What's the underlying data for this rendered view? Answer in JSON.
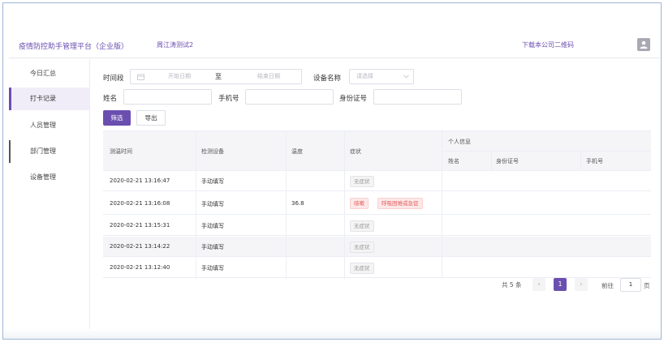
{
  "header": {
    "title": "疫情防控助手管理平台（企业版）",
    "tenant": "周江涛测试2",
    "qr_link": "下载本公司二维码"
  },
  "sidebar": {
    "items": [
      {
        "label": "今日汇总"
      },
      {
        "label": "打卡记录"
      },
      {
        "label": "人员管理"
      },
      {
        "label": "部门管理"
      },
      {
        "label": "设备管理"
      }
    ]
  },
  "filters": {
    "time_label": "时间段",
    "start_placeholder": "开始日期",
    "to_label": "至",
    "end_placeholder": "结束日期",
    "device_label": "设备名称",
    "device_placeholder": "请选择",
    "name_label": "姓名",
    "phone_label": "手机号",
    "id_label": "身份证号",
    "filter_button": "筛选",
    "export_button": "导出"
  },
  "table": {
    "columns": {
      "time": "测温时间",
      "device": "检测设备",
      "temp": "温度",
      "symptom": "症状",
      "personal": "个人信息",
      "name": "姓名",
      "id": "身份证号",
      "phone": "手机号"
    },
    "rows": [
      {
        "time": "2020-02-21 13:16:47",
        "device": "手动填写",
        "temp": "",
        "tag1": "无症状",
        "tag2": ""
      },
      {
        "time": "2020-02-21 13:16:08",
        "device": "手动填写",
        "temp": "36.8",
        "tag1": "咳嗽",
        "tag2": "呼吸困难或急促"
      },
      {
        "time": "2020-02-21 13:15:31",
        "device": "手动填写",
        "temp": "",
        "tag1": "无症状",
        "tag2": ""
      },
      {
        "time": "2020-02-21 13:14:22",
        "device": "手动填写",
        "temp": "",
        "tag1": "无症状",
        "tag2": ""
      },
      {
        "time": "2020-02-21 13:12:40",
        "device": "手动填写",
        "temp": "",
        "tag1": "无症状",
        "tag2": ""
      }
    ]
  },
  "pager": {
    "total": "共 5 条",
    "prev": "‹",
    "current": "1",
    "next": "›",
    "goto_label": "前往",
    "goto_value": "1",
    "page_unit": "页"
  }
}
